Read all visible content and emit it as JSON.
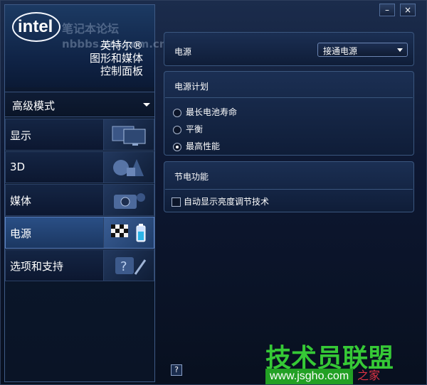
{
  "header": {
    "brand_logo": "intel",
    "brand_lines": [
      "英特尔®",
      "图形和媒体",
      "控制面板"
    ],
    "watermark_title": "笔记本论坛",
    "watermark_url": "nbbbs.zol.com.cn"
  },
  "mode_selector": {
    "value": "高级模式"
  },
  "nav": [
    {
      "label": "显示",
      "icon": "monitor-icon"
    },
    {
      "label": "3D",
      "icon": "3d-shapes-icon"
    },
    {
      "label": "媒体",
      "icon": "camera-icon"
    },
    {
      "label": "电源",
      "icon": "power-flags-icon",
      "active": true
    },
    {
      "label": "选项和支持",
      "icon": "help-tools-icon"
    }
  ],
  "window_controls": {
    "minimize": "–",
    "close": "×"
  },
  "power_source": {
    "label": "电源",
    "selected": "接通电源"
  },
  "power_plan": {
    "title": "电源计划",
    "options": [
      {
        "label": "最长电池寿命",
        "checked": false
      },
      {
        "label": "平衡",
        "checked": false
      },
      {
        "label": "最高性能",
        "checked": true
      }
    ]
  },
  "power_saving": {
    "title": "节电功能",
    "checkbox_label": "自动显示亮度调节技术",
    "checked": false
  },
  "help": {
    "label": "?"
  },
  "footer_watermark": {
    "logo_text": "技术员联盟",
    "url": "www.jsgho.com",
    "tail": "之家"
  },
  "colors": {
    "accent_green": "#36c936",
    "active_nav": "#2a4f86",
    "window_bg": "#0d1731"
  }
}
